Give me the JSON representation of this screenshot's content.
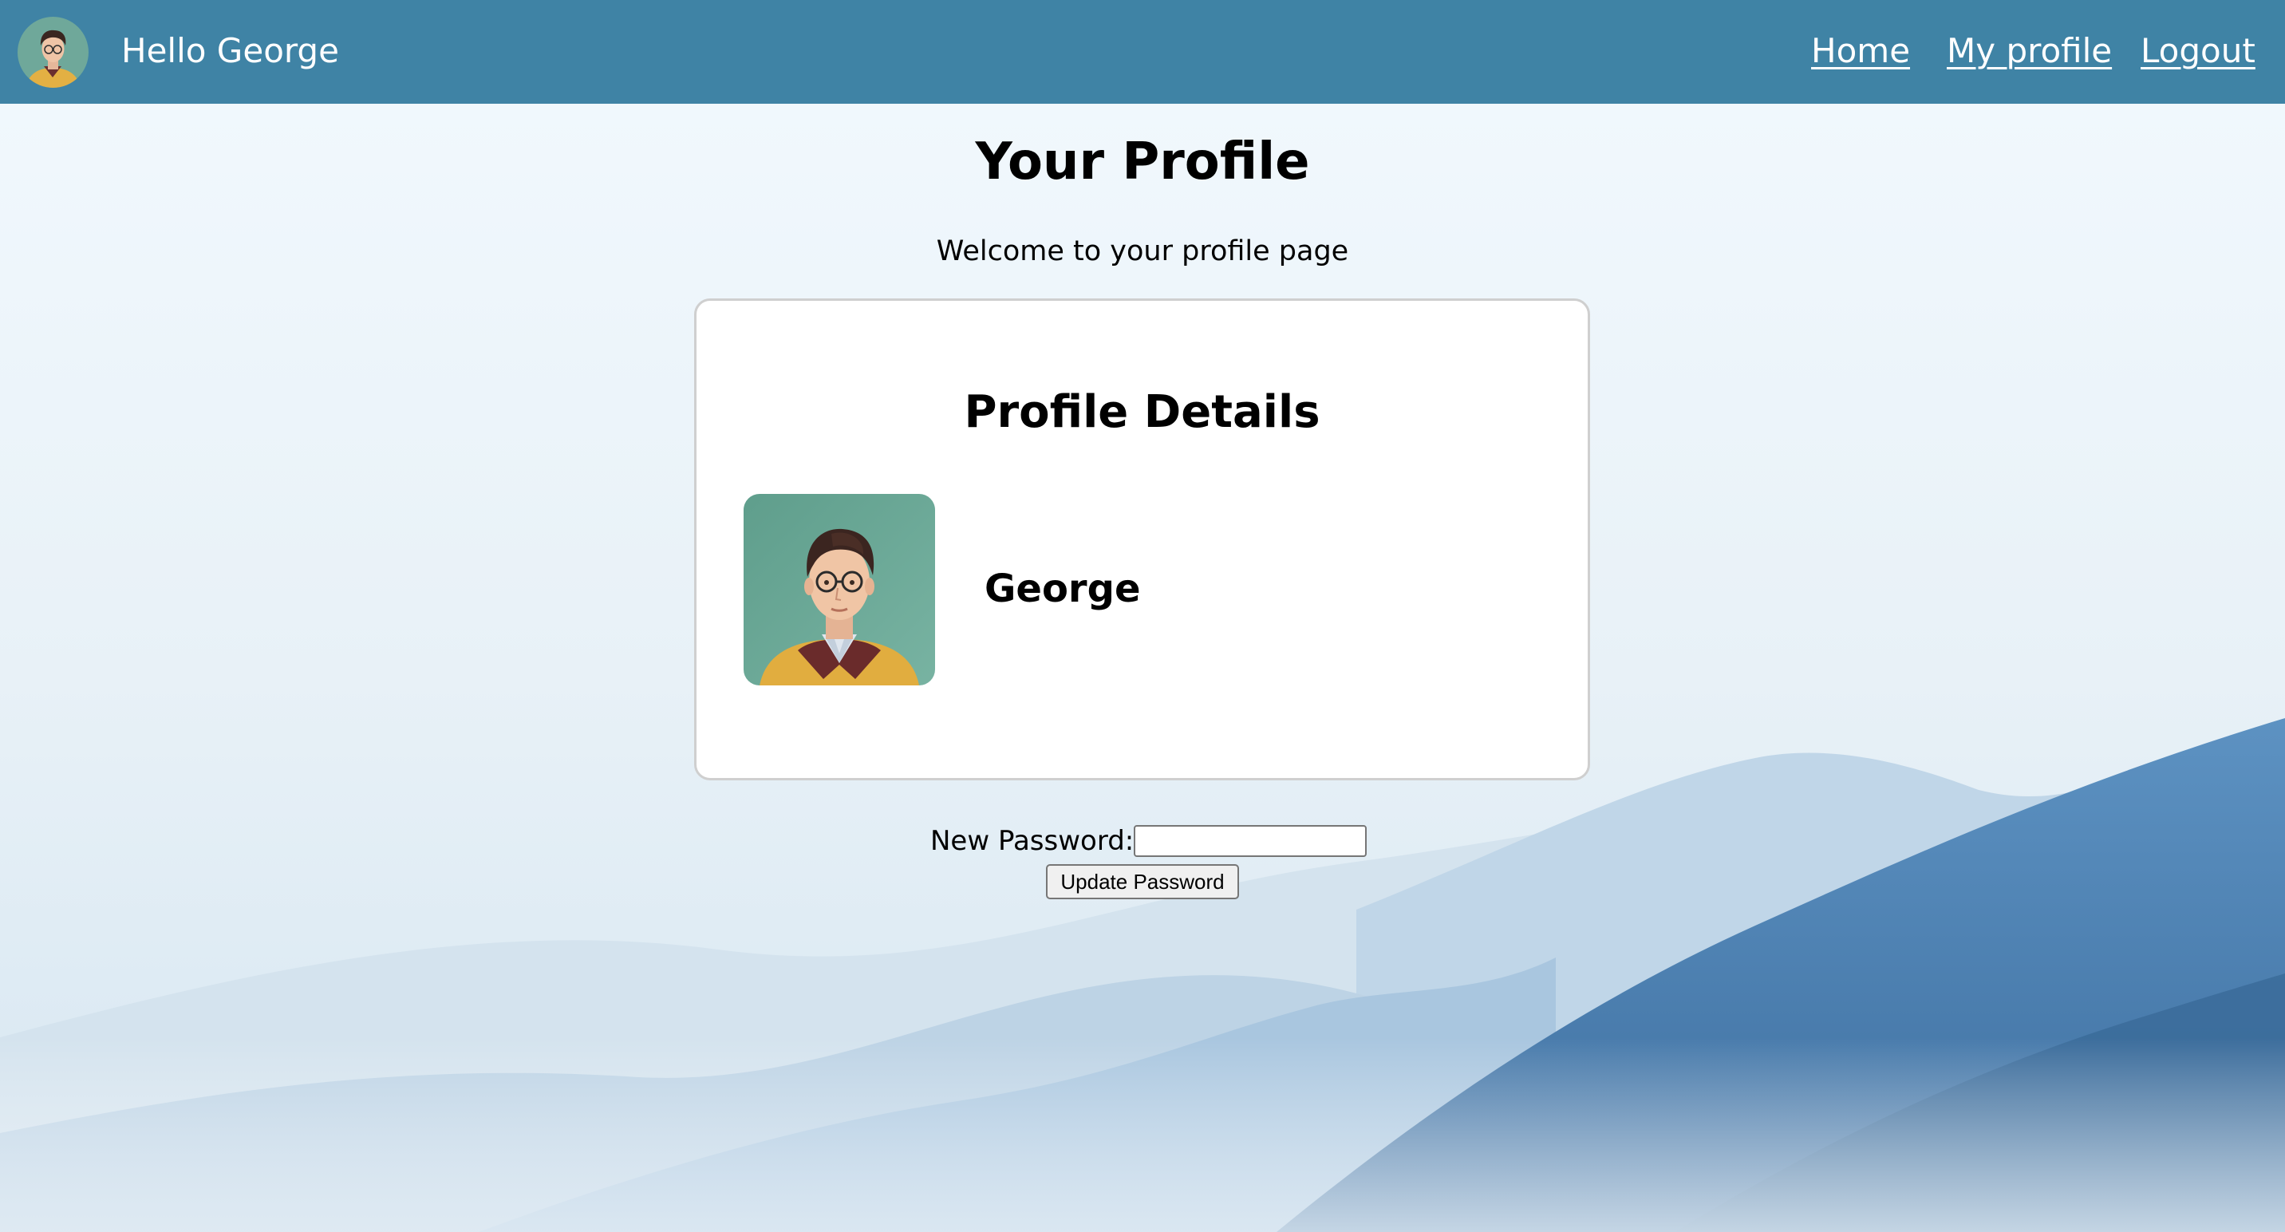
{
  "header": {
    "greeting": "Hello George",
    "nav": {
      "home": "Home",
      "my_profile": "My profile",
      "logout": "Logout"
    },
    "background_color": "#3f83a5"
  },
  "main": {
    "title": "Your Profile",
    "subtitle": "Welcome to your profile page"
  },
  "profile_card": {
    "title": "Profile Details",
    "name": "George"
  },
  "password_form": {
    "label": "New Password:",
    "input_value": "",
    "button_label": "Update Password"
  },
  "icons": {
    "user_avatar": "user-avatar-icon",
    "profile_photo": "profile-photo"
  }
}
